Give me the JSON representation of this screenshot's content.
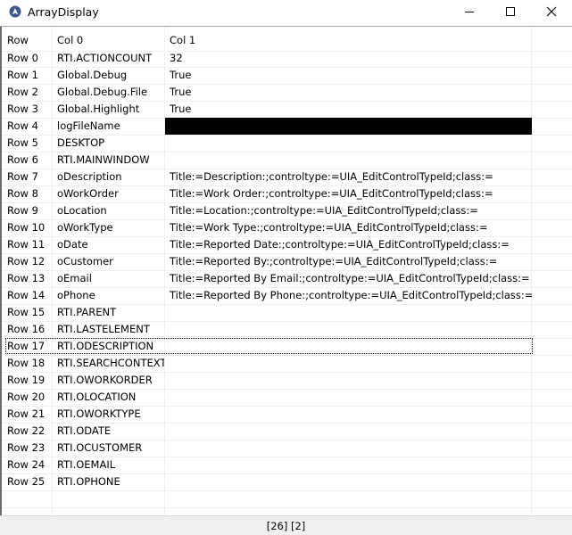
{
  "window": {
    "title": "ArrayDisplay",
    "icon": "app-icon",
    "controls": [
      "minimize-icon",
      "maximize-icon",
      "close-icon"
    ]
  },
  "grid": {
    "headers": [
      "Row",
      "Col 0",
      "Col 1"
    ],
    "rows": [
      {
        "row": "Row 0",
        "col0": "RTI.ACTIONCOUNT",
        "col1": "32"
      },
      {
        "row": "Row 1",
        "col0": "Global.Debug",
        "col1": "True"
      },
      {
        "row": "Row 2",
        "col0": "Global.Debug.File",
        "col1": "True"
      },
      {
        "row": "Row 3",
        "col0": "Global.Highlight",
        "col1": "True"
      },
      {
        "row": "Row 4",
        "col0": "logFileName",
        "col1": ""
      },
      {
        "row": "Row 5",
        "col0": "DESKTOP",
        "col1": ""
      },
      {
        "row": "Row 6",
        "col0": "RTI.MAINWINDOW",
        "col1": ""
      },
      {
        "row": "Row 7",
        "col0": "oDescription",
        "col1": "Title:=Description:;controltype:=UIA_EditControlTypeId;class:="
      },
      {
        "row": "Row 8",
        "col0": "oWorkOrder",
        "col1": "Title:=Work Order:;controltype:=UIA_EditControlTypeId;class:="
      },
      {
        "row": "Row 9",
        "col0": "oLocation",
        "col1": "Title:=Location:;controltype:=UIA_EditControlTypeId;class:="
      },
      {
        "row": "Row 10",
        "col0": "oWorkType",
        "col1": "Title:=Work Type:;controltype:=UIA_EditControlTypeId;class:="
      },
      {
        "row": "Row 11",
        "col0": "oDate",
        "col1": "Title:=Reported Date:;controltype:=UIA_EditControlTypeId;class:="
      },
      {
        "row": "Row 12",
        "col0": "oCustomer",
        "col1": "Title:=Reported By:;controltype:=UIA_EditControlTypeId;class:="
      },
      {
        "row": "Row 13",
        "col0": "oEmail",
        "col1": "Title:=Reported By Email:;controltype:=UIA_EditControlTypeId;class:="
      },
      {
        "row": "Row 14",
        "col0": "oPhone",
        "col1": "Title:=Reported By Phone:;controltype:=UIA_EditControlTypeId;class:="
      },
      {
        "row": "Row 15",
        "col0": "RTI.PARENT",
        "col1": ""
      },
      {
        "row": "Row 16",
        "col0": "RTI.LASTELEMENT",
        "col1": ""
      },
      {
        "row": "Row 17",
        "col0": "RTI.ODESCRIPTION",
        "col1": ""
      },
      {
        "row": "Row 18",
        "col0": "RTI.SEARCHCONTEXT",
        "col1": ""
      },
      {
        "row": "Row 19",
        "col0": "RTI.OWORKORDER",
        "col1": ""
      },
      {
        "row": "Row 20",
        "col0": "RTI.OLOCATION",
        "col1": ""
      },
      {
        "row": "Row 21",
        "col0": "RTI.OWORKTYPE",
        "col1": ""
      },
      {
        "row": "Row 22",
        "col0": "RTI.ODATE",
        "col1": ""
      },
      {
        "row": "Row 23",
        "col0": "RTI.OCUSTOMER",
        "col1": ""
      },
      {
        "row": "Row 24",
        "col0": "RTI.OEMAIL",
        "col1": ""
      },
      {
        "row": "Row 25",
        "col0": "RTI.OPHONE",
        "col1": ""
      }
    ]
  },
  "statusbar": {
    "text": "[26] [2]"
  }
}
